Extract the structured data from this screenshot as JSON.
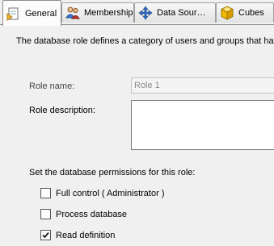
{
  "tabs": [
    {
      "label": "General",
      "active": true,
      "icon": "general-page-icon"
    },
    {
      "label": "Membership",
      "active": false,
      "icon": "users-icon"
    },
    {
      "label": "Data Sour…",
      "active": false,
      "icon": "data-sources-icon"
    },
    {
      "label": "Cubes",
      "active": false,
      "icon": "cube-icon"
    }
  ],
  "general": {
    "intro": "The database role defines a category of users and groups that hav",
    "role_name_label": "Role name:",
    "role_name_value": "Role 1",
    "role_description_label": "Role description:",
    "role_description_value": "",
    "permissions_heading": "Set the database permissions for this role:",
    "permissions": [
      {
        "label": "Full control ( Administrator )",
        "checked": false
      },
      {
        "label": "Process database",
        "checked": false
      },
      {
        "label": "Read definition",
        "checked": true
      }
    ]
  }
}
